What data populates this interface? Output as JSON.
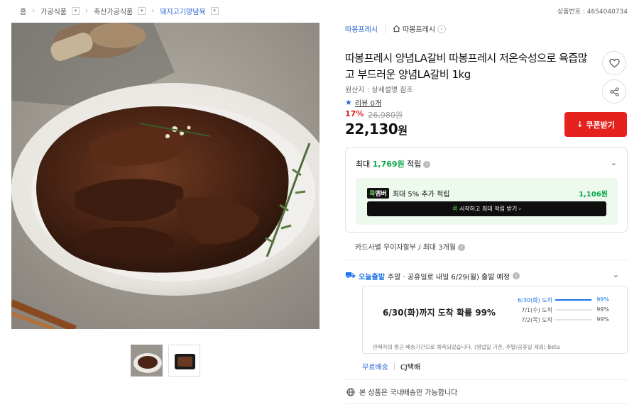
{
  "breadcrumb": {
    "items": [
      "홈",
      "가공식품",
      "축산가공식품",
      "돼지고기양념육"
    ],
    "product_number": "상품번호 : 4654040734"
  },
  "shop": {
    "name": "따봉프레시",
    "link_label": "따봉프레시"
  },
  "product": {
    "title": "따봉프레시 양념LA갈비 따봉프레시 저온숙성으로 육즙많고 부드러운 양념LA갈비 1kg",
    "origin": "원산지 : 상세설명 참조",
    "review_label": "리뷰 0개",
    "discount": "17%",
    "original_price": "26,980원",
    "price": "22,130",
    "price_unit": "원",
    "coupon_label": "쿠폰받기"
  },
  "points": {
    "prefix": "최대 ",
    "amount": "1,769원",
    "suffix": " 적립",
    "member_badge_a": "쿡",
    "member_badge_b": "멤버",
    "member_text": "최대 5% 추가 적립",
    "member_amount": "1,106원",
    "member_btn_a": "쿡",
    "member_btn_b": " 시작하고 최대 적립 받기 ›"
  },
  "installment": "카드사별 무이자할부 / 최대 3개월",
  "shipping": {
    "today_label": "오늘출발",
    "text": "주말 · 공휴일로 내일 6/29(월) 출발 예정",
    "probability": "6/30(화)까지 도착 확률 99%",
    "dates": [
      {
        "label": "6/30(화) 도착",
        "pct": "99%",
        "fill": 99
      },
      {
        "label": "7/1(수) 도착",
        "pct": "99%",
        "fill": 0
      },
      {
        "label": "7/2(목) 도착",
        "pct": "99%",
        "fill": 0
      }
    ],
    "note": "판매자의 평균 배송기간으로 예측되었습니다. (영업일 기준, 주말/공휴일 제외) Beta",
    "free_label": "무료배송",
    "carrier": "CJ택배",
    "domestic": "본 상품은 국내배송만 가능합니다"
  },
  "colors": {
    "accent_blue": "#2a62d6",
    "coupon_red": "#e5221e",
    "point_green": "#0aa64a"
  }
}
